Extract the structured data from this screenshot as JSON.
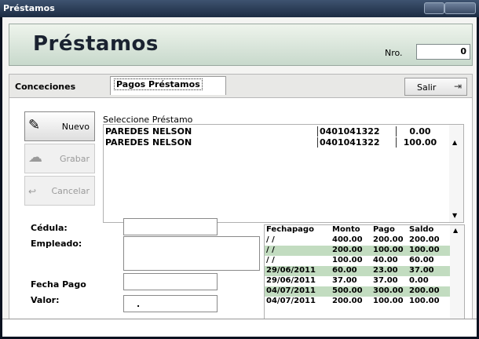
{
  "window": {
    "title": "Préstamos"
  },
  "header": {
    "title": "Préstamos",
    "nro_label": "Nro.",
    "nro_value": "0"
  },
  "tabs": [
    {
      "label": "Conceciones"
    },
    {
      "label": "Pagos Préstamos"
    }
  ],
  "toolbar": {
    "exit_label": "Salir"
  },
  "actions": {
    "new_label": "Nuevo",
    "save_label": "Grabar",
    "cancel_label": "Cancelar"
  },
  "loans": {
    "title": "Seleccione Préstamo",
    "rows": [
      {
        "name": "PAREDES NELSON",
        "cedula": "0401041322",
        "amount": "0.00"
      },
      {
        "name": "PAREDES NELSON",
        "cedula": "0401041322",
        "amount": "100.00"
      }
    ]
  },
  "form": {
    "cedula_label": "Cédula:",
    "empleado_label": "Empleado:",
    "fecha_label": "Fecha Pago",
    "valor_label": "Valor:",
    "valor_value": "."
  },
  "payments": {
    "headers": [
      "Fechapago",
      "Monto",
      "Pago",
      "Saldo"
    ],
    "rows": [
      {
        "fecha": "/ /",
        "monto": "400.00",
        "pago": "200.00",
        "saldo": "200.00",
        "highlight": false
      },
      {
        "fecha": "/ /",
        "monto": "200.00",
        "pago": "100.00",
        "saldo": "100.00",
        "highlight": true
      },
      {
        "fecha": "/ /",
        "monto": "100.00",
        "pago": "40.00",
        "saldo": "60.00",
        "highlight": false
      },
      {
        "fecha": "29/06/2011",
        "monto": "60.00",
        "pago": "23.00",
        "saldo": "37.00",
        "highlight": true
      },
      {
        "fecha": "29/06/2011",
        "monto": "37.00",
        "pago": "37.00",
        "saldo": "0.00",
        "highlight": false
      },
      {
        "fecha": "04/07/2011",
        "monto": "500.00",
        "pago": "300.00",
        "saldo": "200.00",
        "highlight": true
      },
      {
        "fecha": "04/07/2011",
        "monto": "200.00",
        "pago": "100.00",
        "saldo": "100.00",
        "highlight": false
      }
    ]
  },
  "icons": {
    "new": "new-record-icon",
    "save": "save-cloud-icon",
    "cancel": "undo-icon",
    "exit": "exit-door-icon",
    "scroll_up": "chevron-up-icon",
    "scroll_down": "chevron-down-icon"
  }
}
